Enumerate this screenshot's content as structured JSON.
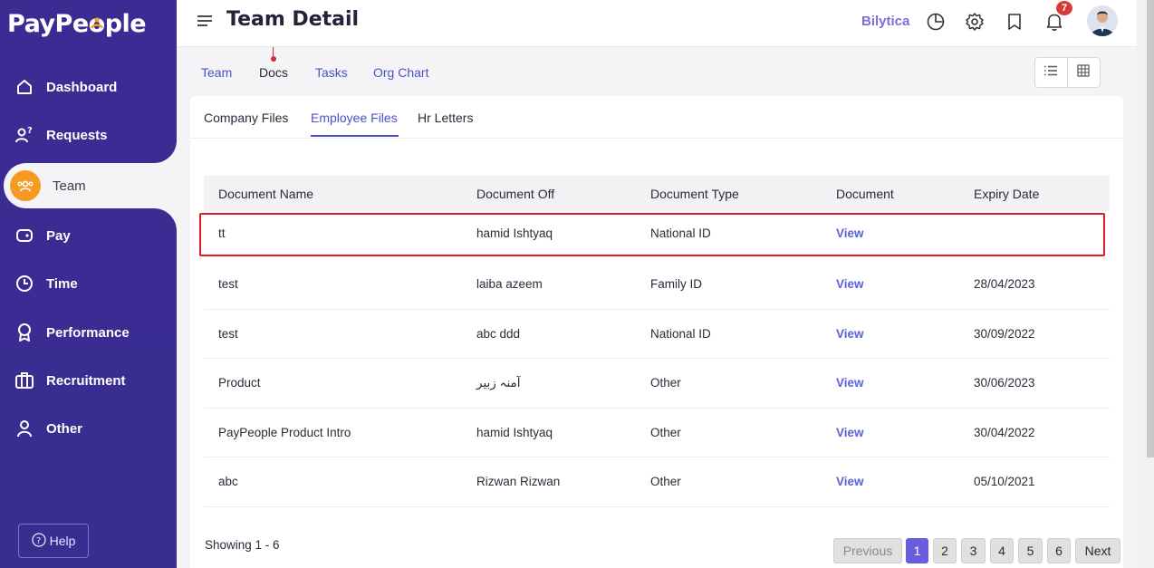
{
  "brand": {
    "logo_text_a": "PayPe",
    "logo_text_b": "ple"
  },
  "sidebar": {
    "items": [
      {
        "label": "Dashboard",
        "icon": "home-icon"
      },
      {
        "label": "Requests",
        "icon": "requests-icon"
      },
      {
        "label": "Team",
        "icon": "team-icon"
      },
      {
        "label": "Pay",
        "icon": "wallet-icon"
      },
      {
        "label": "Time",
        "icon": "clock-icon"
      },
      {
        "label": "Performance",
        "icon": "award-icon"
      },
      {
        "label": "Recruitment",
        "icon": "briefcase-icon"
      },
      {
        "label": "Other",
        "icon": "user-icon"
      }
    ],
    "active": "Team",
    "help_label": "Help"
  },
  "header": {
    "title": "Team Detail",
    "company": "Bilytica",
    "notification_count": "7",
    "icons": [
      "pie-chart-icon",
      "gear-icon",
      "bookmark-icon",
      "bell-icon"
    ]
  },
  "top_tabs": [
    "Team",
    "Docs",
    "Tasks",
    "Org Chart"
  ],
  "top_tab_active": "Docs",
  "sub_tabs": [
    "Company Files",
    "Employee Files",
    "Hr Letters"
  ],
  "sub_tab_active": "Employee Files",
  "table": {
    "headers": [
      "Document Name",
      "Document Off",
      "Document Type",
      "Document",
      "Expiry Date"
    ],
    "rows": [
      {
        "name": "tt",
        "off": "hamid Ishtyaq",
        "type": "National ID",
        "doc": "View",
        "expiry": ""
      },
      {
        "name": "test",
        "off": "laiba azeem",
        "type": "Family ID",
        "doc": "View",
        "expiry": "28/04/2023"
      },
      {
        "name": "test",
        "off": "abc ddd",
        "type": "National ID",
        "doc": "View",
        "expiry": "30/09/2022"
      },
      {
        "name": "Product",
        "off": "آمنہ زبیر",
        "type": "Other",
        "doc": "View",
        "expiry": "30/06/2023"
      },
      {
        "name": "PayPeople Product Intro",
        "off": "hamid Ishtyaq",
        "type": "Other",
        "doc": "View",
        "expiry": "30/04/2022"
      },
      {
        "name": "abc",
        "off": "Rizwan Rizwan",
        "type": "Other",
        "doc": "View",
        "expiry": "05/10/2021"
      }
    ]
  },
  "pagination": {
    "showing": "Showing 1 - 6",
    "previous": "Previous",
    "pages": [
      "1",
      "2",
      "3",
      "4",
      "5",
      "6"
    ],
    "current": "1",
    "next": "Next"
  },
  "colors": {
    "sidebar": "#3b2c93",
    "accent": "#4a52c8",
    "active_icon": "#f59a23",
    "highlight": "#e31b23",
    "badge": "#d83a3a"
  }
}
